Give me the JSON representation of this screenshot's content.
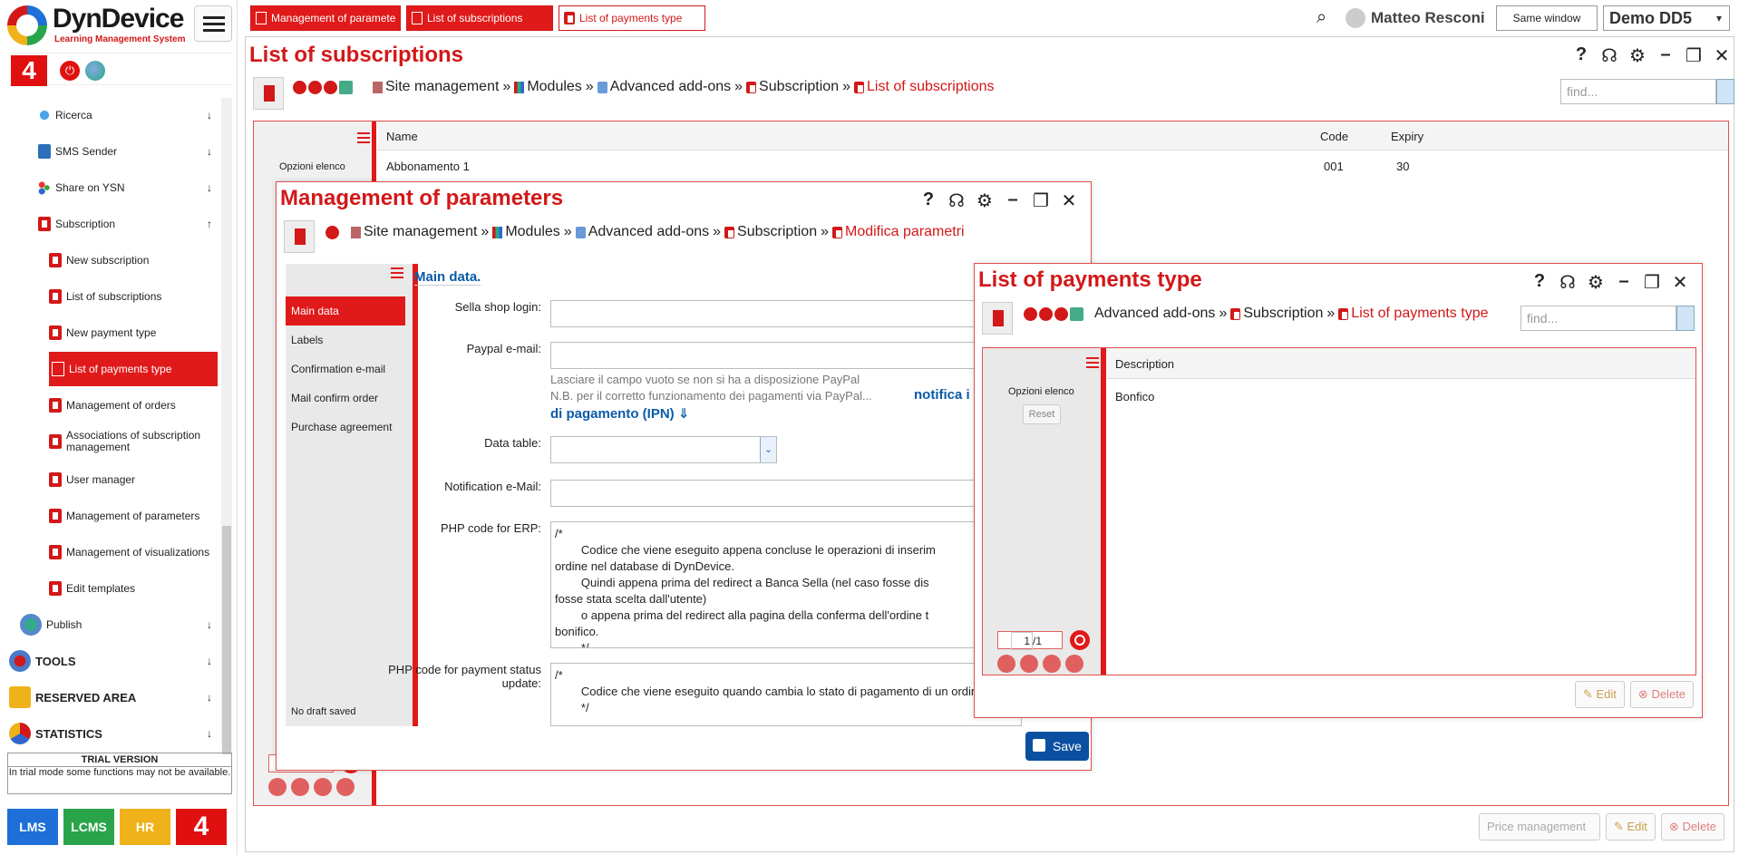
{
  "logo": {
    "name": "DynDevice",
    "subtitle": "Learning Management System"
  },
  "sidebar": {
    "badge": "4",
    "items": [
      {
        "label": "Ricerca",
        "arrow": "↓"
      },
      {
        "label": "SMS Sender",
        "arrow": "↓"
      },
      {
        "label": "Share on YSN",
        "arrow": "↓"
      },
      {
        "label": "Subscription",
        "arrow": "↑"
      },
      {
        "label": "New subscription"
      },
      {
        "label": "List of subscriptions"
      },
      {
        "label": "New payment type"
      },
      {
        "label": "List of payments type"
      },
      {
        "label": "Management of orders"
      },
      {
        "label": "Associations of subscription management"
      },
      {
        "label": "User manager"
      },
      {
        "label": "Management of parameters"
      },
      {
        "label": "Management of visualizations"
      },
      {
        "label": "Edit templates"
      },
      {
        "label": "Publish",
        "arrow": "↓"
      },
      {
        "label": "TOOLS",
        "arrow": "↓"
      },
      {
        "label": "RESERVED AREA",
        "arrow": "↓"
      },
      {
        "label": "STATISTICS",
        "arrow": "↓"
      }
    ],
    "trial_title": "TRIAL VERSION",
    "trial_text": "In trial mode some functions may not be available.",
    "apps": [
      "LMS",
      "LCMS",
      "HR",
      "4"
    ]
  },
  "topbar": {
    "tabs": [
      "Management of paramete",
      "List of subscriptions",
      "List of payments type"
    ],
    "user": "Matteo Resconi",
    "same_window": "Same window",
    "instance": "Demo DD5"
  },
  "main": {
    "title": "List of subscriptions",
    "breadcrumb": [
      "Site management",
      "Modules",
      "Advanced add-ons",
      "Subscription",
      "List of subscriptions"
    ],
    "find_placeholder": "find...",
    "list_options": "Opzioni elenco",
    "columns": [
      "Name",
      "Code",
      "Expiry"
    ],
    "rows": [
      {
        "name": "Abbonamento 1",
        "code": "001",
        "expiry": "30"
      }
    ],
    "buttons": {
      "price": "Price management",
      "edit": "Edit",
      "delete": "Delete"
    }
  },
  "params_window": {
    "title": "Management of parameters",
    "breadcrumb": [
      "Site management",
      "Modules",
      "Advanced add-ons",
      "Subscription",
      "Modifica parametri"
    ],
    "tabs": [
      "Main data",
      "Labels",
      "Confirmation e-mail",
      "Mail confirm order",
      "Purchase agreement"
    ],
    "draft": "No draft saved",
    "section": "Main data.",
    "fields": {
      "sella": "Sella shop login:",
      "paypal": "Paypal e-mail:",
      "paypal_hint1": "Lasciare il campo vuoto se non si ha a disposizione PayPal",
      "paypal_hint2": "N.B. per il corretto funzionamento dei pagamenti via PayPal...",
      "paypal_link1": "notifica i",
      "paypal_link2": "di pagamento (IPN) ⇓",
      "data_table": "Data table:",
      "notification": "Notification e-Mail:",
      "php_erp": "PHP code for ERP:",
      "php_erp_code": "/*\n        Codice che viene eseguito appena concluse le operazioni di inserim\nordine nel database di DynDevice.\n        Quindi appena prima del redirect a Banca Sella (nel caso fosse dis\nfosse stata scelta dall'utente)\n        o appena prima del redirect alla pagina della conferma dell'ordine t\nbonifico.\n        */",
      "php_status": "PHP code for payment status update:",
      "php_status_code": "/*\n        Codice che viene eseguito quando cambia lo stato di pagamento di un ordine.\n        */"
    },
    "save": "Save"
  },
  "payments_window": {
    "title": "List of payments type",
    "breadcrumb": [
      "Advanced add-ons",
      "Subscription",
      "List of payments type"
    ],
    "find_placeholder": "find...",
    "list_options": "Opzioni elenco",
    "reset": "Reset",
    "column": "Description",
    "rows": [
      "Bonfico"
    ],
    "page": "1",
    "pages": "/1",
    "buttons": {
      "edit": "Edit",
      "delete": "Delete"
    }
  },
  "win_icons": [
    "help-icon",
    "support-icon",
    "settings-icon",
    "minimize-icon",
    "maximize-icon",
    "close-icon"
  ]
}
